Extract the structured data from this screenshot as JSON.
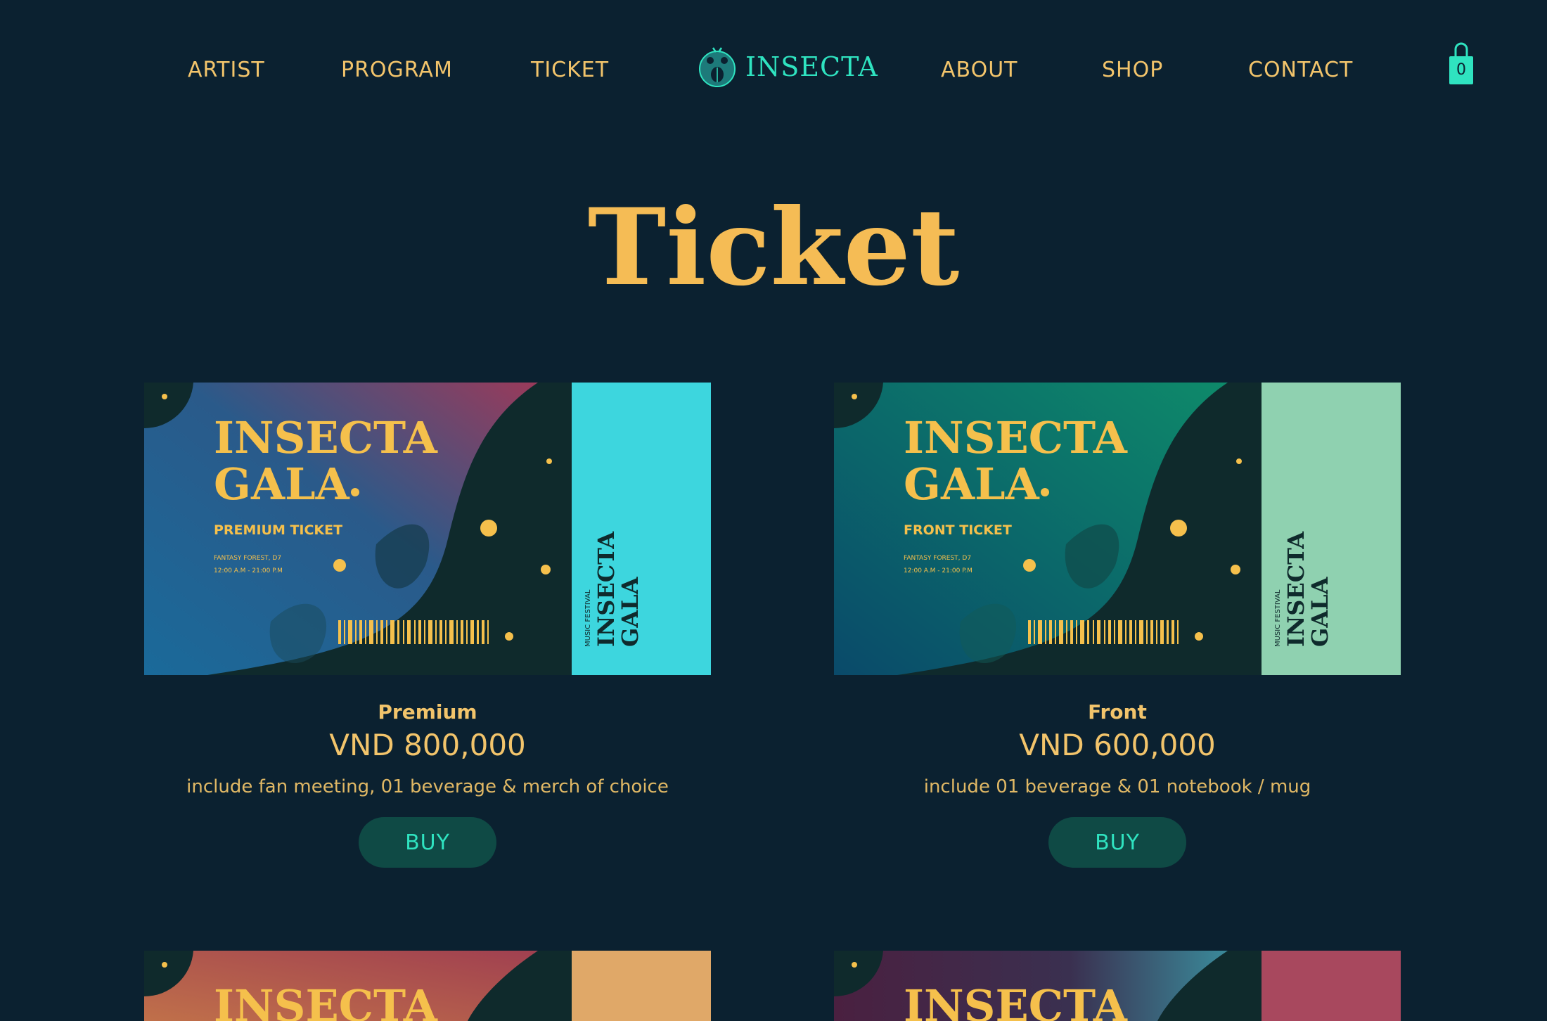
{
  "nav": {
    "links_left": [
      "ARTIST",
      "PROGRAM",
      "TICKET"
    ],
    "brand": "INSECTA",
    "links_right": [
      "ABOUT",
      "SHOP",
      "CONTACT"
    ],
    "cart_count": "0"
  },
  "page": {
    "title": "Ticket"
  },
  "tickets": [
    {
      "tier": "Premium",
      "price": "VND 800,000",
      "description": "include fan meeting, 01 beverage & merch of choice",
      "buy_label": "BUY",
      "image": {
        "title_line1": "INSECTA",
        "title_line2": "GALA",
        "type": "PREMIUM TICKET",
        "venue": "FANTASY FOREST, D7",
        "time": "12:00 A.M - 21:00 P.M",
        "stub_small": "MUSIC FESTIVAL",
        "stub_title1": "INSECTA",
        "stub_title2": "GALA",
        "colors": {
          "grad_a": "#1a6a9a",
          "grad_b": "#9a3a5a",
          "stub": "#3dd6de"
        }
      }
    },
    {
      "tier": "Front",
      "price": "VND 600,000",
      "description": "include 01 beverage & 01 notebook / mug",
      "buy_label": "BUY",
      "image": {
        "title_line1": "INSECTA",
        "title_line2": "GALA",
        "type": "FRONT TICKET",
        "venue": "FANTASY FOREST, D7",
        "time": "12:00 A.M - 21:00 P.M",
        "stub_small": "MUSIC FESTIVAL",
        "stub_title1": "INSECTA",
        "stub_title2": "GALA",
        "colors": {
          "grad_a": "#0a4a6a",
          "grad_b": "#0e8a6a",
          "stub": "#8fd1b0"
        }
      }
    }
  ],
  "partial_tickets": [
    {
      "title_line1": "INSECTA",
      "colors": {
        "grad_a": "#c0704a",
        "grad_b": "#a04050",
        "stub": "#e0a868"
      }
    },
    {
      "title_line1": "INSECTA",
      "colors": {
        "grad_a": "#4a2040",
        "grad_b": "#3a8a9a",
        "stub": "#a8485e"
      }
    }
  ],
  "theme": {
    "background": "#0b2130",
    "gold": "#f5bc55",
    "teal": "#2fe3c0",
    "button_bg": "#0f4a45"
  }
}
